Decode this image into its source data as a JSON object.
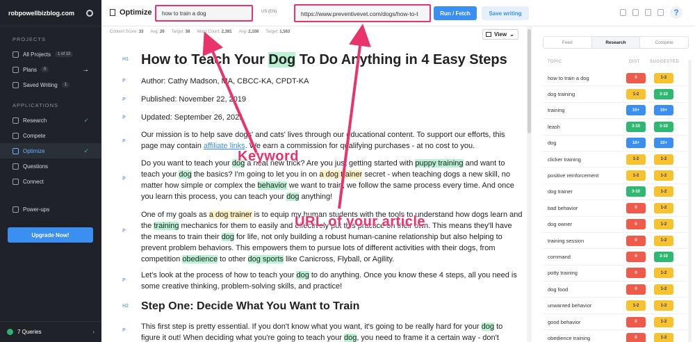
{
  "sidebar": {
    "site": "robpowellbizblog.com",
    "projects_label": "PROJECTS",
    "projects": [
      {
        "label": "All Projects",
        "badge": "1 of 10"
      },
      {
        "label": "Plans",
        "badge": "0"
      },
      {
        "label": "Saved Writing",
        "badge": "1"
      }
    ],
    "applications_label": "APPLICATIONS",
    "apps": [
      {
        "label": "Research",
        "check": "✓"
      },
      {
        "label": "Compete"
      },
      {
        "label": "Optimize",
        "check": "✓"
      },
      {
        "label": "Questions"
      },
      {
        "label": "Connect"
      }
    ],
    "powerups": "Power-ups",
    "upgrade": "Upgrade Now!",
    "queries": "7 Queries"
  },
  "topbar": {
    "title": "Optimize",
    "keyword": "how to train a dog",
    "locale": "US (EN)",
    "url": "https://www.preventivevet.com/dogs/how-to-t",
    "run": "Run / Fetch",
    "save": "Save writing",
    "help": "?"
  },
  "stats": {
    "content_score_label": "Content Score:",
    "content_score": "33",
    "avg_label": "Avg:",
    "avg": "26",
    "target_label": "Target:",
    "target": "38",
    "word_count_label": "Word Count:",
    "word_count": "2,381",
    "wc_avg": "2,108",
    "wc_target": "1,563"
  },
  "view_label": "View",
  "editor": {
    "h1": [
      "How to Teach Your ",
      "Dog",
      " To Do Anything in 4 Easy Steps"
    ],
    "author": "Author: Cathy Madson, MA, CBCC-KA, CPDT-KA",
    "published": "Published: November 22, 2019",
    "updated": "Updated: September 26, 2021",
    "p1": [
      "Our mission is to help save dogs' and cats' lives through our educational content. To support our efforts, this page may contain ",
      "affiliate links",
      ". We earn a commission for qualifying purchases - at no cost to you."
    ],
    "p2": [
      "Do you want to teach your ",
      "dog",
      " a neat new trick? Are you just getting started with ",
      "puppy training",
      " and want to teach your ",
      "dog",
      " the basics? I'm going to let you in on ",
      "a dog trainer",
      " secret - when teaching dogs a new skill, no matter how simple or complex the ",
      "behavior",
      " we want to train, we follow the same process every time. And once you learn this process, you can teach your ",
      "dog",
      " anything!"
    ],
    "p3": [
      "One of my goals as ",
      "a dog trainer",
      " is to equip my human students with the tools to understand how dogs learn and the ",
      "training",
      " mechanics for them to easily and effectively put this practice on their own. This means they'll have the means to train their ",
      "dog",
      " for life, not only building a robust human-canine relationship but also helping to prevent problem behaviors. This empowers them to pursue lots of different activities with their dogs, from competition ",
      "obedience",
      " to other ",
      "dog sports",
      " like Canicross, Flyball, or Agility."
    ],
    "p4": [
      "Let's look at the process of how to teach your ",
      "dog",
      " to do anything. Once you know these 4 steps, all you need is some creative thinking, problem-solving skills, and practice!"
    ],
    "h2": "Step One: Decide What You Want to Train",
    "p5": [
      "This first step is pretty essential. If you don't know what you want, it's going to be really hard for your ",
      "dog",
      " to figure it out! When deciding what you're going to teach your ",
      "dog",
      ", you need to frame it a certain way - don't"
    ]
  },
  "tags": {
    "h1": "H1",
    "p": "P",
    "h2": "H2"
  },
  "panel": {
    "tabs": [
      "Feed",
      "Research",
      "Compete"
    ],
    "headers": {
      "topic": "TOPIC",
      "dist": "DIST",
      "suggested": "SUGGESTED"
    },
    "rows": [
      {
        "topic": "how to train a dog",
        "dist": "0",
        "dc": "red",
        "sugg": "1-2",
        "sc": "yellow"
      },
      {
        "topic": "dog training",
        "dist": "1-2",
        "dc": "yellow",
        "sugg": "3-10",
        "sc": "green"
      },
      {
        "topic": "training",
        "dist": "10+",
        "dc": "blue",
        "sugg": "10+",
        "sc": "blue"
      },
      {
        "topic": "leash",
        "dist": "3-10",
        "dc": "green",
        "sugg": "3-10",
        "sc": "green"
      },
      {
        "topic": "dog",
        "dist": "10+",
        "dc": "blue",
        "sugg": "10+",
        "sc": "blue"
      },
      {
        "topic": "clicker training",
        "dist": "1-2",
        "dc": "yellow",
        "sugg": "1-2",
        "sc": "yellow"
      },
      {
        "topic": "positive reinforcement",
        "dist": "1-2",
        "dc": "yellow",
        "sugg": "1-2",
        "sc": "yellow"
      },
      {
        "topic": "dog trainer",
        "dist": "3-10",
        "dc": "green",
        "sugg": "1-2",
        "sc": "yellow"
      },
      {
        "topic": "bad behavior",
        "dist": "0",
        "dc": "red",
        "sugg": "1-2",
        "sc": "yellow"
      },
      {
        "topic": "dog owner",
        "dist": "0",
        "dc": "red",
        "sugg": "1-2",
        "sc": "yellow"
      },
      {
        "topic": "training session",
        "dist": "0",
        "dc": "red",
        "sugg": "1-2",
        "sc": "yellow"
      },
      {
        "topic": "command",
        "dist": "0",
        "dc": "red",
        "sugg": "3-10",
        "sc": "green"
      },
      {
        "topic": "potty training",
        "dist": "0",
        "dc": "red",
        "sugg": "1-2",
        "sc": "yellow"
      },
      {
        "topic": "dog food",
        "dist": "0",
        "dc": "red",
        "sugg": "1-2",
        "sc": "yellow"
      },
      {
        "topic": "unwanted behavior",
        "dist": "1-2",
        "dc": "yellow",
        "sugg": "1-2",
        "sc": "yellow"
      },
      {
        "topic": "good behavior",
        "dist": "0",
        "dc": "red",
        "sugg": "1-2",
        "sc": "yellow"
      },
      {
        "topic": "obedience training",
        "dist": "0",
        "dc": "red",
        "sugg": "1-2",
        "sc": "yellow"
      }
    ]
  },
  "annotations": {
    "keyword": "Keyword",
    "url": "URL of your article"
  }
}
